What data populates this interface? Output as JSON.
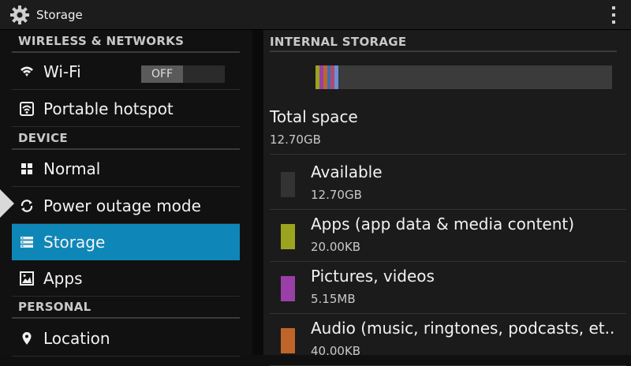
{
  "titlebar": {
    "title": "Storage",
    "icon": "gear-icon",
    "menu_icon": "overflow-menu-icon"
  },
  "sidebar": {
    "sections": [
      {
        "header": "WIRELESS & NETWORKS"
      },
      {
        "header": "DEVICE"
      },
      {
        "header": "PERSONAL"
      }
    ],
    "items": [
      {
        "label": "Wi-Fi",
        "icon": "wifi-icon",
        "toggle": "OFF"
      },
      {
        "label": "Portable hotspot",
        "icon": "hotspot-icon"
      },
      {
        "label": "Normal",
        "icon": "grid-icon"
      },
      {
        "label": "Power outage mode",
        "icon": "refresh-icon"
      },
      {
        "label": "Storage",
        "icon": "storage-icon",
        "selected": true
      },
      {
        "label": "Apps",
        "icon": "apps-icon"
      },
      {
        "label": "Location",
        "icon": "location-pin-icon"
      }
    ]
  },
  "main": {
    "header": "INTERNAL STORAGE",
    "total": {
      "label": "Total space",
      "value": "12.70GB"
    },
    "rows": [
      {
        "label": "Available",
        "value": "12.70GB",
        "color": "#333333"
      },
      {
        "label": "Apps (app data & media content)",
        "value": "20.00KB",
        "color": "#9aa41e"
      },
      {
        "label": "Pictures, videos",
        "value": "5.15MB",
        "color": "#9b3fa8"
      },
      {
        "label": "Audio (music, ringtones, podcasts, et..",
        "value": "40.00KB",
        "color": "#c0652a"
      }
    ],
    "bar_segments": [
      "#9aa41e",
      "#9b3fa8",
      "#c0652a",
      "#3b6fb0",
      "#b04a6f",
      "#6a8fd6"
    ]
  },
  "colors": {
    "accent": "#0e87b8"
  }
}
